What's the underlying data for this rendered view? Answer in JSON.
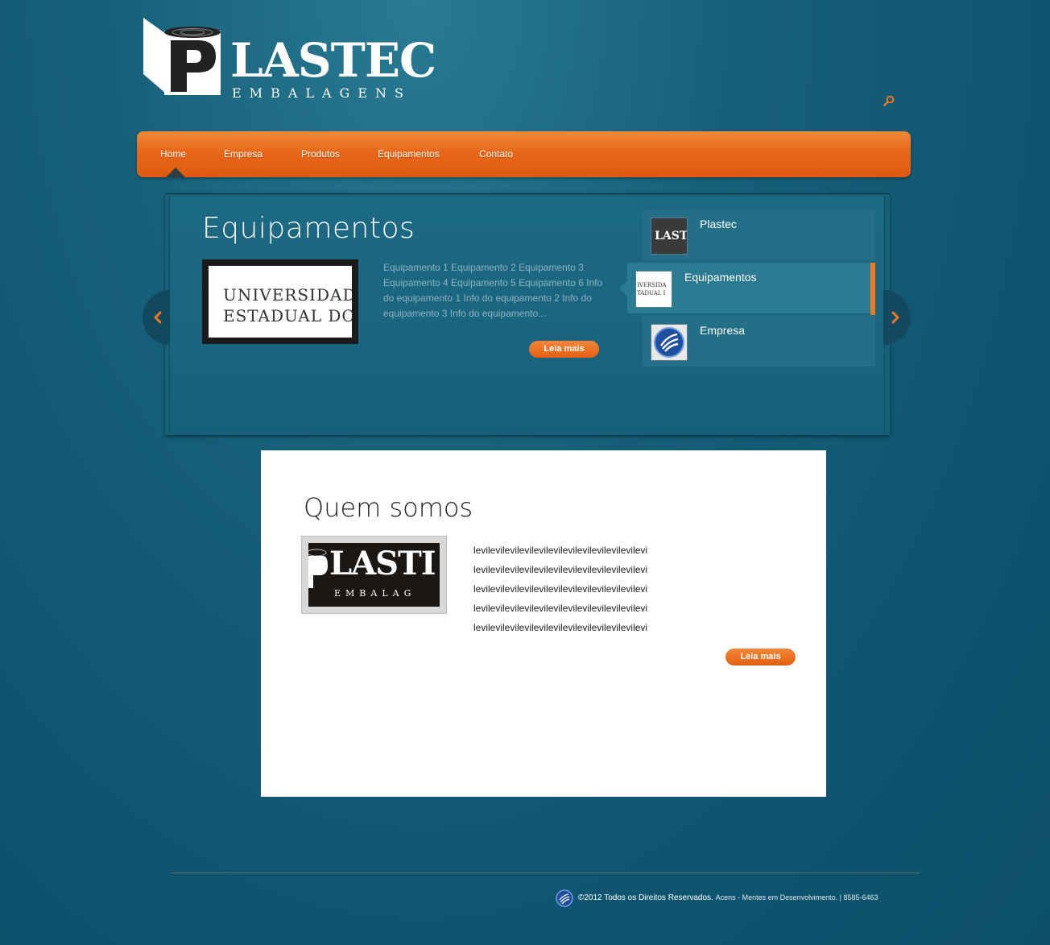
{
  "brand": {
    "name": "PLASTEC",
    "wordmark": "LASTEC",
    "initial": "P",
    "subtitle": "EMBALAGENS"
  },
  "header": {
    "search_icon": "search-icon"
  },
  "nav": {
    "items": [
      "Home",
      "Empresa",
      "Produtos",
      "Equipamentos",
      "Contato"
    ],
    "active": "Home"
  },
  "slider": {
    "title": "Equipamentos",
    "image_text": [
      "UNIVERSIDADE",
      "ESTADUAL DO C"
    ],
    "text": "Equipamento 1 Equipamento 2 Equipamento 3 Equipamento 4 Equipamento 5 Equipamento 6 Info do equipamento 1 Info do equipamento 2 Info do equipamento 3 Info do equipamento...",
    "button": "Leia mais",
    "thumbs": [
      {
        "label": "Plastec",
        "thumb_text": "LAST"
      },
      {
        "label": "Equipamentos",
        "thumb_text": "IVERSIDA\nTADUAL I"
      },
      {
        "label": "Empresa"
      }
    ],
    "active_thumb": "Equipamentos"
  },
  "about": {
    "title": "Quem somos",
    "image_text": [
      "LASTI",
      "EMBALAG"
    ],
    "lines": [
      "levilevilevilevilevilevilevilevilevilevilevilevi",
      "levilevilevilevilevilevilevilevilevilevilevilevi",
      "levilevilevilevilevilevilevilevilevilevilevilevi",
      "levilevilevilevilevilevilevilevilevilevilevilevi",
      "levilevilevilevilevilevilevilevilevilevilevilevi"
    ],
    "button": "Leia mais"
  },
  "footer": {
    "copyright": "©2012 Todos os Direitos Reservados.",
    "credit": "Acens - Mentes em Desenvolvimento. | 8585-6463"
  },
  "colors": {
    "accent": "#e8671a",
    "background": "#17607a",
    "panel": "#ffffff"
  }
}
